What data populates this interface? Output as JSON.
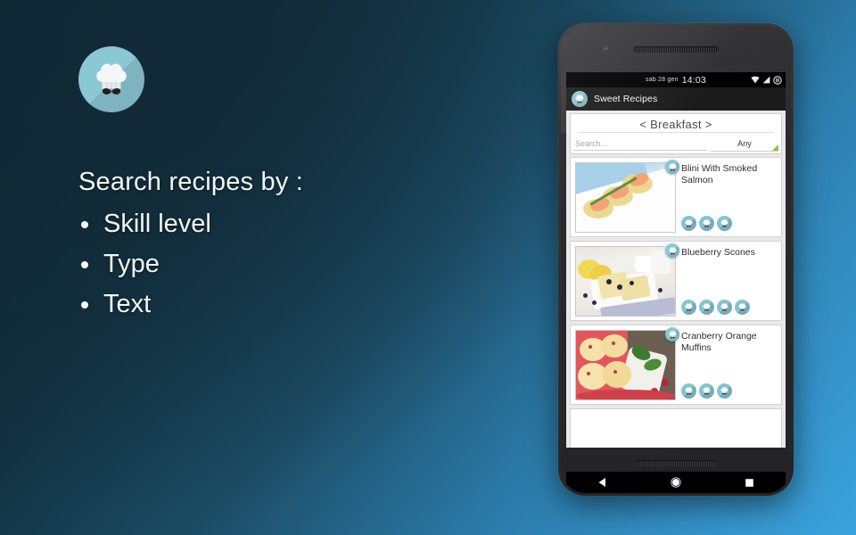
{
  "promo": {
    "logo_icon": "chef-hat-mustache-icon",
    "headline": "Search recipes by :",
    "features": [
      "Skill level",
      "Type",
      "Text"
    ]
  },
  "phone": {
    "statusbar": {
      "date": "sab 28 gen",
      "time": "14:03",
      "icons": [
        "wifi-icon",
        "cellular-signal-icon",
        "battery-icon"
      ]
    },
    "appbar": {
      "logo_icon": "chef-hat-app-icon",
      "title": "Sweet Recipes"
    },
    "category": {
      "prev_icon": "chevron-left-icon",
      "label": "Breakfast",
      "next_icon": "chevron-right-icon",
      "display": "< Breakfast >"
    },
    "search": {
      "placeholder": "Search...",
      "value": "",
      "type_filter": "Any",
      "type_filter_accent": "#8bc34a"
    },
    "recipes": [
      {
        "title": "Blini With Smoked Salmon",
        "image": "blini-with-smoked-salmon-photo",
        "skill_level": 3,
        "badge_icon": "chef-hat-icon"
      },
      {
        "title": "Blueberry Scones",
        "image": "blueberry-scones-photo",
        "skill_level": 4,
        "badge_icon": "chef-hat-icon"
      },
      {
        "title": "Cranberry Orange Muffins",
        "image": "cranberry-orange-muffins-photo",
        "skill_level": 3,
        "badge_icon": "chef-hat-icon"
      }
    ],
    "navbar": {
      "back": "back-triangle-icon",
      "home": "home-circle-icon",
      "recents": "recents-square-icon"
    }
  },
  "colors": {
    "brand_teal": "#8cc7d6",
    "background_dark": "#0d232e",
    "background_light": "#3ba3dd",
    "accent_green": "#8bc34a"
  }
}
